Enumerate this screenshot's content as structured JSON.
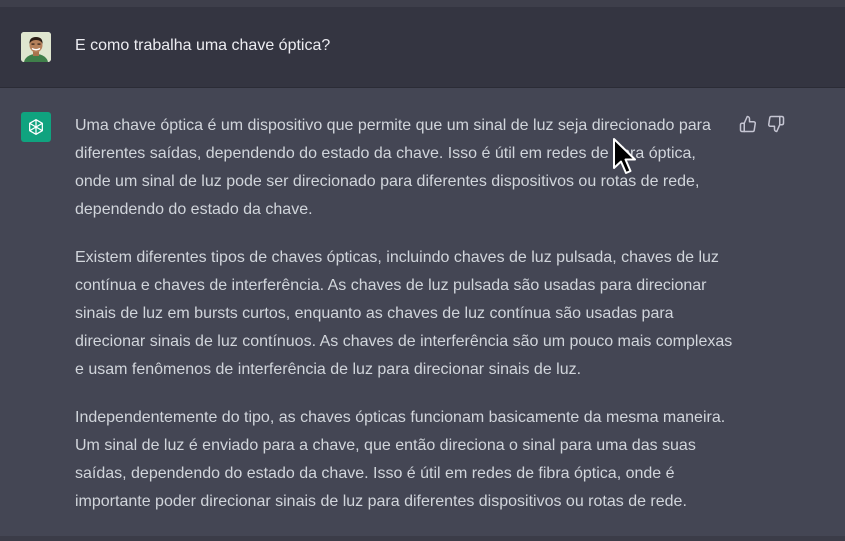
{
  "user_message": {
    "avatar_icon": "user-avatar-photo",
    "text": "E como trabalha uma chave óptica?"
  },
  "assistant_message": {
    "avatar_icon": "openai-logo-icon",
    "avatar_color": "#10a37f",
    "paragraphs": [
      "Uma chave óptica é um dispositivo que permite que um sinal de luz seja direcionado para diferentes saídas, dependendo do estado da chave. Isso é útil em redes de fibra óptica, onde um sinal de luz pode ser direcionado para diferentes dispositivos ou rotas de rede, dependendo do estado da chave.",
      "Existem diferentes tipos de chaves ópticas, incluindo chaves de luz pulsada, chaves de luz contínua e chaves de interferência. As chaves de luz pulsada são usadas para direcionar sinais de luz em bursts curtos, enquanto as chaves de luz contínua são usadas para direcionar sinais de luz contínuos. As chaves de interferência são um pouco mais complexas e usam fenômenos de interferência de luz para direcionar sinais de luz.",
      "Independentemente do tipo, as chaves ópticas funcionam basicamente da mesma maneira. Um sinal de luz é enviado para a chave, que então direciona o sinal para uma das suas saídas, dependendo do estado da chave. Isso é útil em redes de fibra óptica, onde é importante poder direcionar sinais de luz para diferentes dispositivos ou rotas de rede."
    ],
    "feedback_icons": [
      "thumbs-up-icon",
      "thumbs-down-icon"
    ]
  },
  "colors": {
    "user_row_bg": "#343541",
    "assistant_row_bg": "#444654",
    "text": "#d1d5db"
  }
}
